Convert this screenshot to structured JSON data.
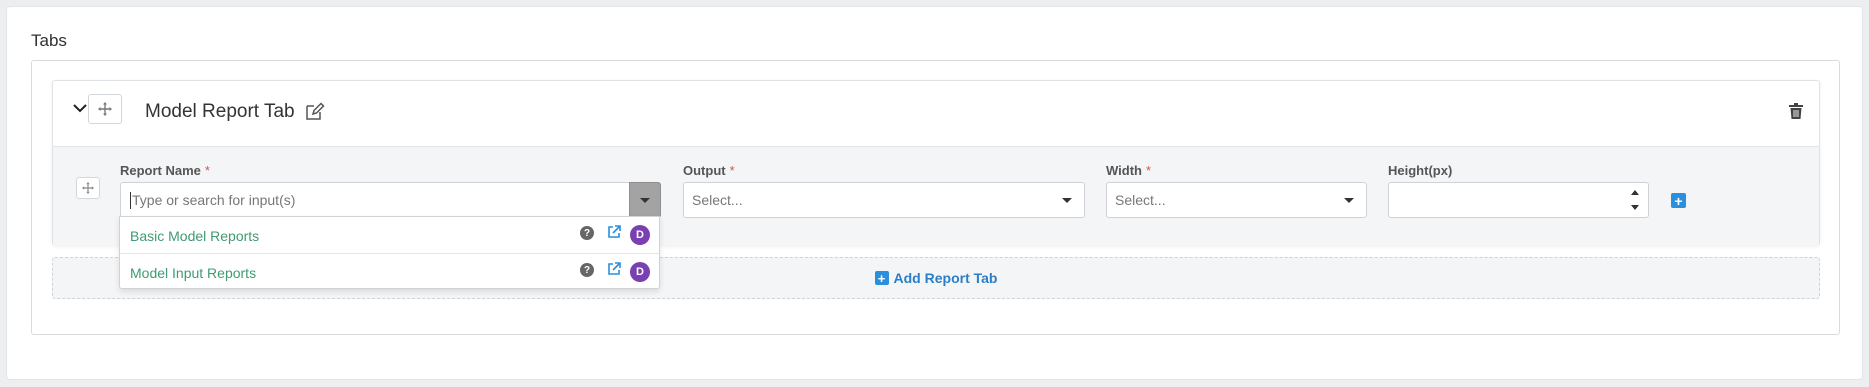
{
  "section": {
    "title": "Tabs"
  },
  "tab": {
    "title": "Model Report Tab",
    "fields": {
      "report_name": {
        "label": "Report Name",
        "required_mark": "*",
        "placeholder": "Type or search for input(s)"
      },
      "output": {
        "label": "Output",
        "required_mark": "*",
        "value": "Select..."
      },
      "width": {
        "label": "Width",
        "required_mark": "*",
        "value": "Select..."
      },
      "height": {
        "label": "Height(px)",
        "value": ""
      }
    },
    "add_field_label": "+"
  },
  "dropdown": {
    "items": [
      {
        "name": "Basic Model Reports",
        "help": "?",
        "badge": "D"
      },
      {
        "name": "Model Input Reports",
        "help": "?",
        "badge": "D"
      }
    ]
  },
  "add_tab": {
    "icon": "+",
    "label": "Add Report Tab"
  },
  "colors": {
    "accent": "#2a8fdc",
    "link_green": "#3e9b73",
    "badge_purple": "#7a3fb0",
    "required_red": "#d9534f"
  },
  "icons": [
    "chevron-down-icon",
    "move-icon",
    "edit-icon",
    "trash-icon",
    "help-icon",
    "external-link-icon",
    "plus-icon"
  ]
}
